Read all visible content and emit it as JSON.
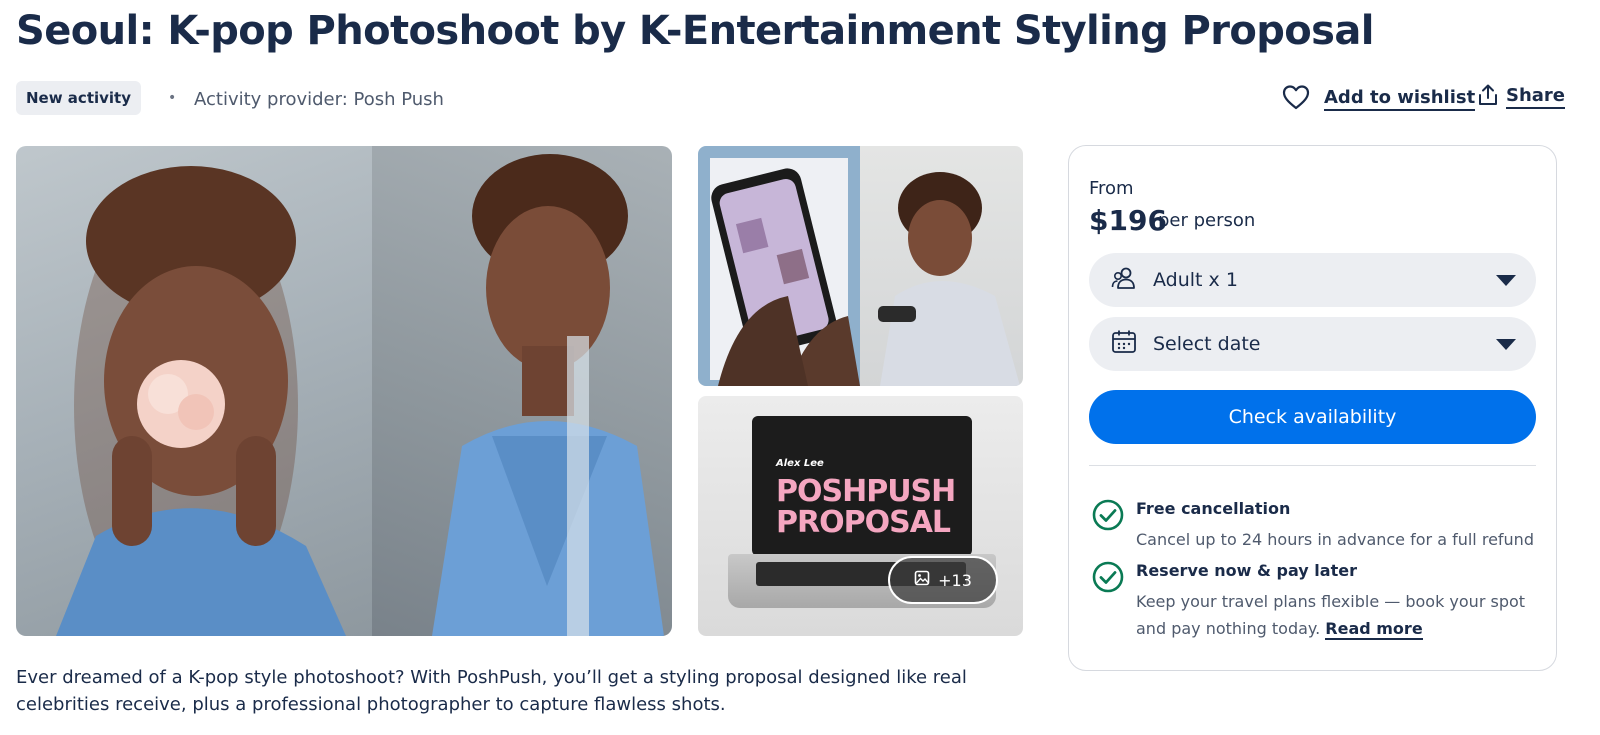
{
  "activity": {
    "title": "Seoul: K-pop Photoshoot by K-Entertainment Styling Proposal",
    "badge": "New activity",
    "separator": "•",
    "provider": "Activity provider: Posh Push",
    "description": "Ever dreamed of a K-pop style photoshoot? With PoshPush, you’ll get a styling proposal designed like real celebrities receive, plus a professional photographer to capture flawless shots."
  },
  "actions": {
    "wishlist_label": "Add to wishlist",
    "wishlist_icon": "heart-icon",
    "share_label": "Share",
    "share_icon": "share-icon"
  },
  "gallery": {
    "more_label": "+13",
    "more_icon": "image-icon",
    "laptop_screen_name": "Alex Lee",
    "laptop_screen_brand_line1": "POSHPUSH",
    "laptop_screen_brand_line2": "PROPOSAL"
  },
  "booking": {
    "from_label": "From",
    "price": "$196",
    "per_person": "per person",
    "participants": {
      "value": "Adult x 1",
      "icon": "users-icon"
    },
    "date": {
      "value": "Select date",
      "icon": "calendar-icon"
    },
    "check_button": "Check availability",
    "accent_color": "#0071eb",
    "check_color": "#0a7a54"
  },
  "features": [
    {
      "title": "Free cancellation",
      "description": "Cancel up to 24 hours in advance for a full refund"
    },
    {
      "title": "Reserve now & pay later",
      "description": "Keep your travel plans flexible — book your spot and pay nothing today.",
      "link": "Read more"
    }
  ]
}
